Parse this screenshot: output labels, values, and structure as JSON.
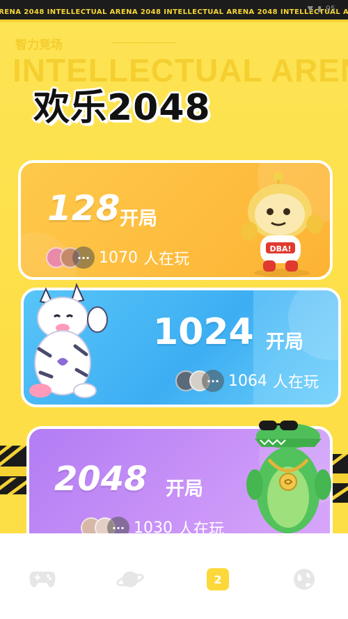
{
  "tape": {
    "text": "ARENA  2048  INTELLECTUAL ARENA  2048  INTELLECTUAL ARENA  2048  INTELLECTUAL ARENA  2048"
  },
  "status": {
    "battery": "95"
  },
  "header": {
    "subtitle": "智力竞场",
    "watermark": "INTELLECTUAL AREN",
    "title": "欢乐2048"
  },
  "cards": [
    {
      "number": "128",
      "suffix": "开局",
      "players_count": "1070",
      "players_suffix": "人在玩",
      "more": "···",
      "color": "#fdb334"
    },
    {
      "number": "1024",
      "suffix": "开局",
      "players_count": "1064",
      "players_suffix": "人在玩",
      "more": "···",
      "color": "#3daef3"
    },
    {
      "number": "2048",
      "suffix": "开局",
      "players_count": "1030",
      "players_suffix": "人在玩",
      "more": "···",
      "color": "#c791f7"
    }
  ],
  "nav": {
    "items": [
      {
        "icon": "gamepad-icon",
        "label": ""
      },
      {
        "icon": "planet-icon",
        "label": ""
      },
      {
        "icon": "tile-2-icon",
        "label": "2",
        "active": true
      },
      {
        "icon": "globe-icon",
        "label": ""
      }
    ],
    "active_color": "#fdd83a",
    "inactive_color": "#e8e8e8"
  }
}
